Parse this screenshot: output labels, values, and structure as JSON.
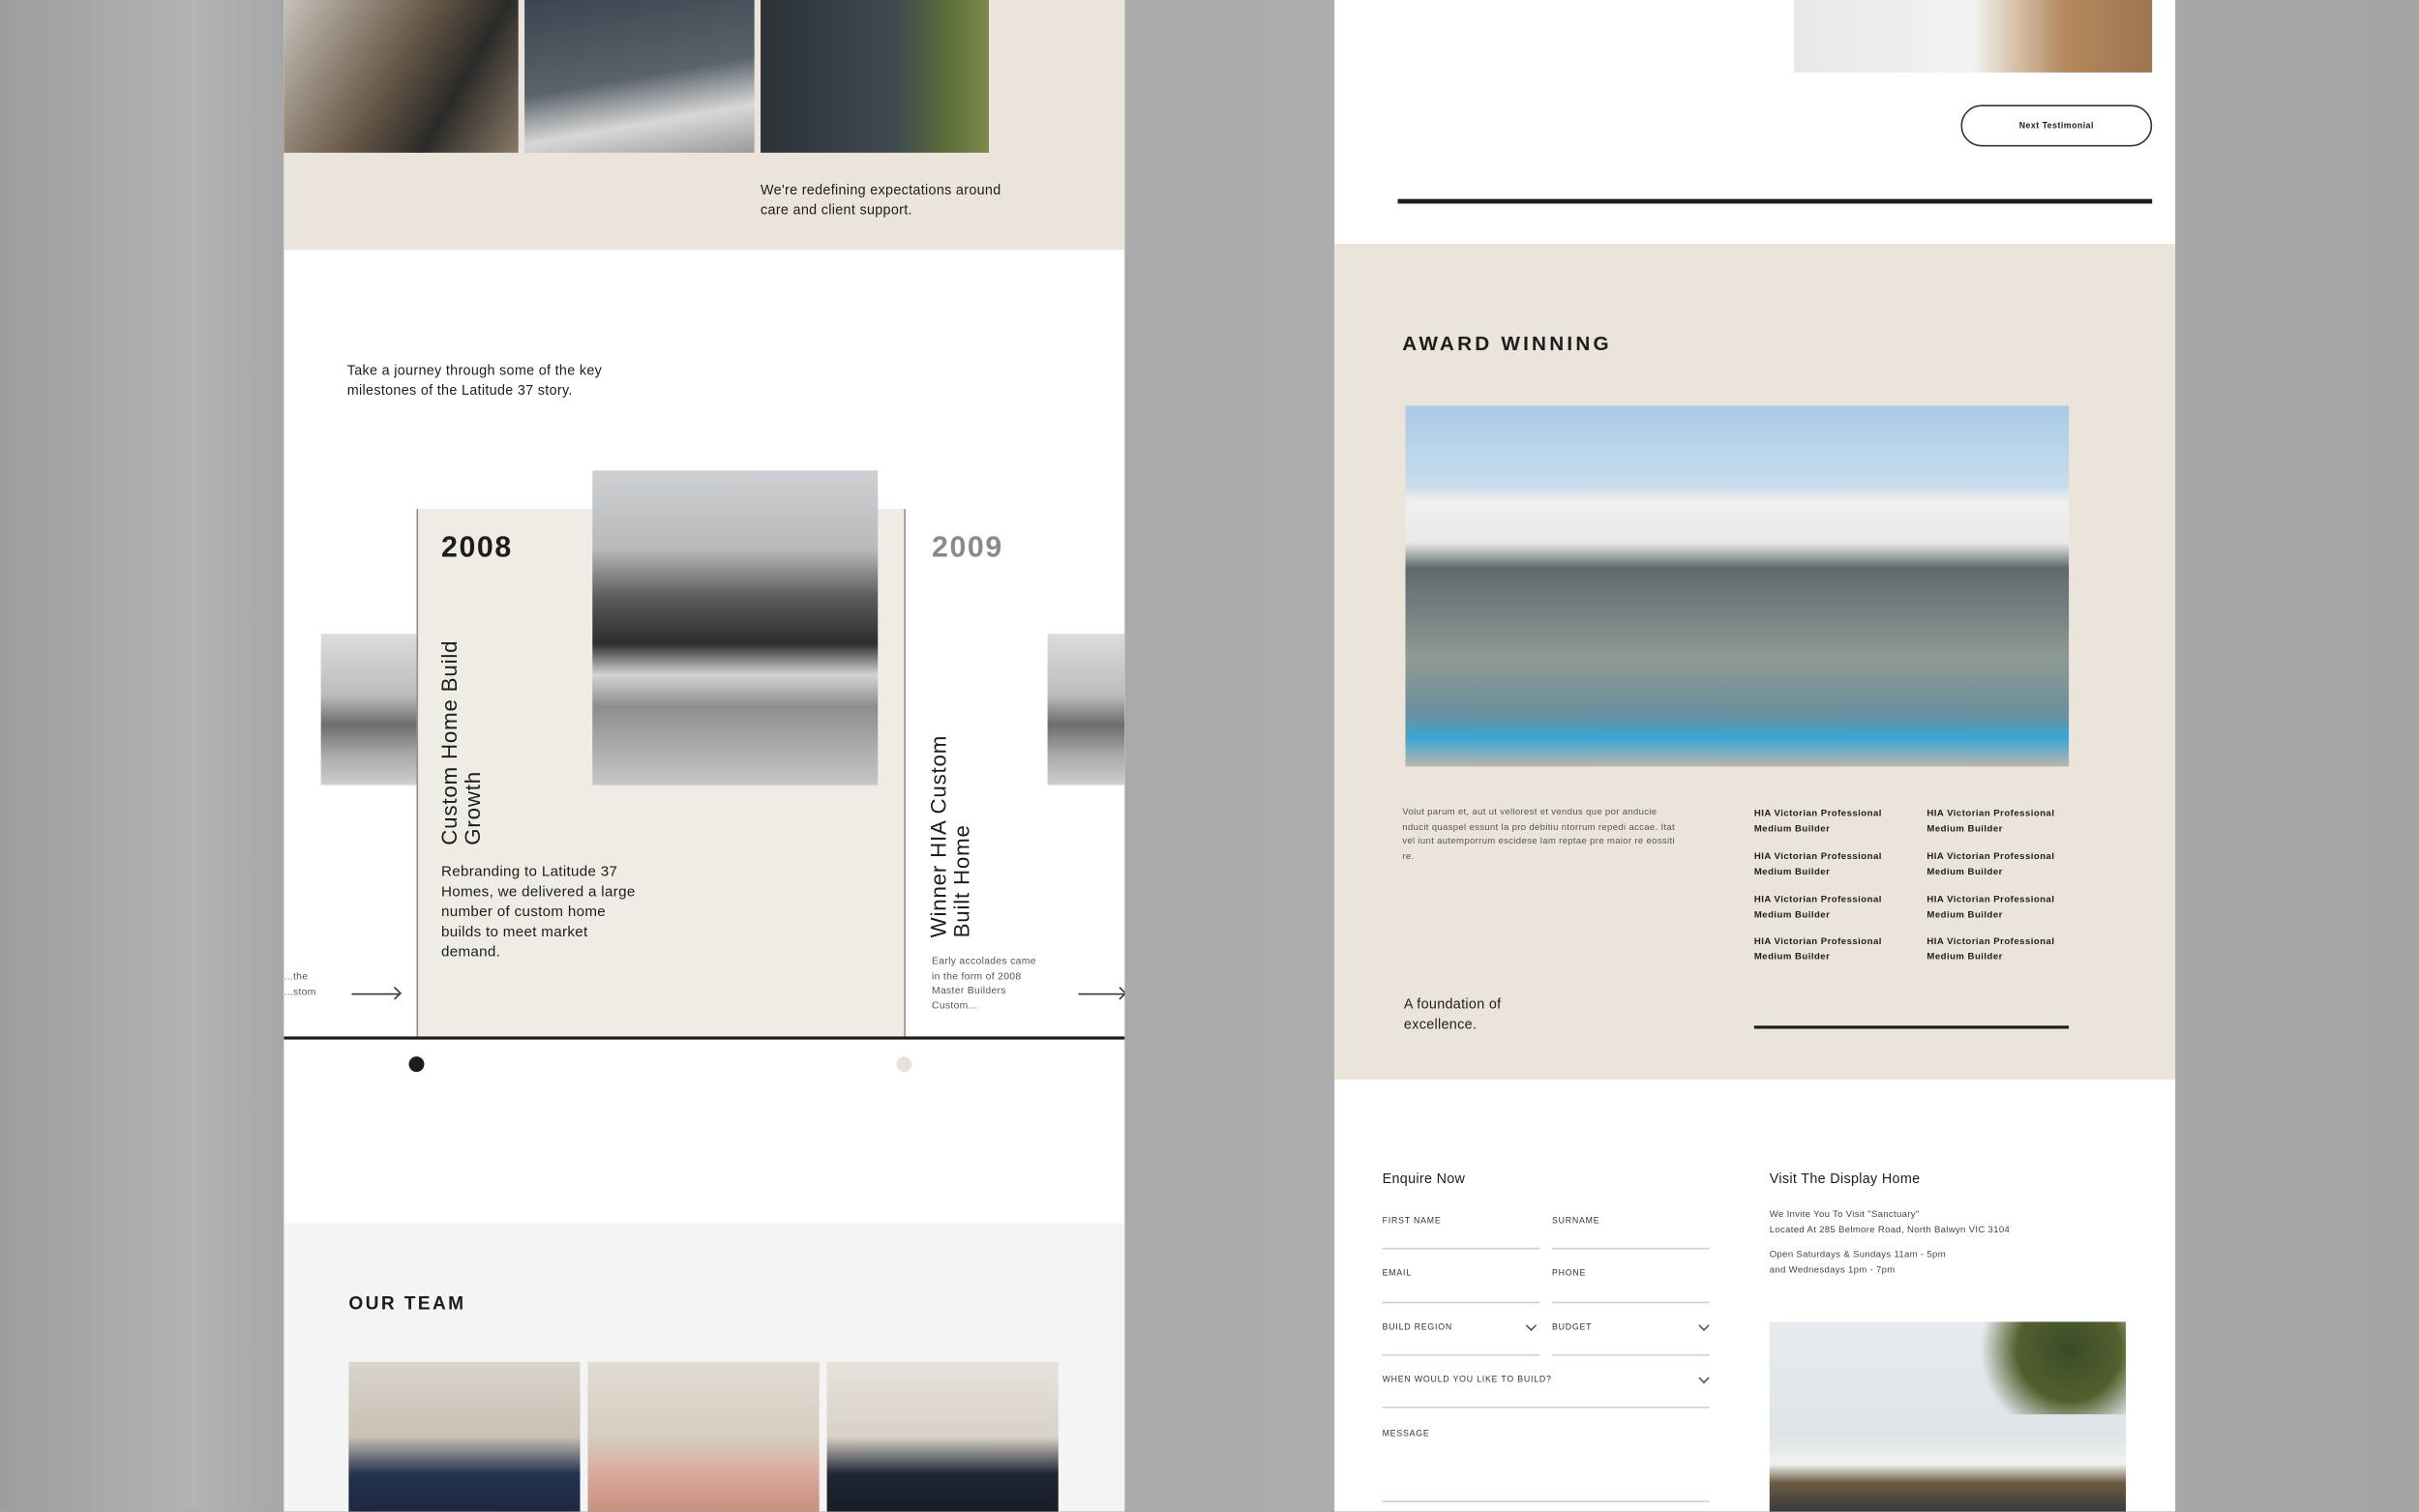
{
  "left_page": {
    "intro_text": "We're redefining expectations around care and client support.",
    "journey_text": "Take a journey through some of the key milestones of the Latitude 37 story.",
    "timeline": [
      {
        "year": "2008",
        "title": "Custom Home Build Growth",
        "description": "Rebranding to Latitude 37 Homes, we delivered a large number of custom home builds to meet market demand.",
        "active": true
      },
      {
        "year": "2009",
        "title": "Winner HIA Custom Built Home",
        "description": "Early accolades came in the form of 2008 Master Builders Custom...",
        "active": false
      }
    ],
    "prev_snippet": "...the ...stom",
    "team_heading": "OUR TEAM"
  },
  "right_page": {
    "next_testimonial_label": "Next Testimonial",
    "award_heading": "AWARD WINNING",
    "award_text": "Volut parum et, aut ut vellorest et vendus que por anducie nducit quaspel essunt la pro debitiu ntorrum repedi accae. Itat vel iunt autemporrum escidese lam reptae pre maior re eossiti re.",
    "awards": [
      "HIA Victorian Professional Medium Builder",
      "HIA Victorian Professional Medium Builder",
      "HIA Victorian Professional Medium Builder",
      "HIA Victorian Professional Medium Builder",
      "HIA Victorian Professional Medium Builder",
      "HIA Victorian Professional Medium Builder",
      "HIA Victorian Professional Medium Builder",
      "HIA Victorian Professional Medium Builder"
    ],
    "foundation_text": "A foundation of excellence.",
    "form": {
      "title": "Enquire Now",
      "first_name": "FIRST NAME",
      "surname": "SURNAME",
      "email": "EMAIL",
      "phone": "PHONE",
      "build_region": "BUILD REGION",
      "budget": "BUDGET",
      "when": "WHEN WOULD YOU LIKE TO BUILD?",
      "message": "MESSAGE"
    },
    "display_home": {
      "title": "Visit The Display Home",
      "line1": "We Invite You To Visit \"Sanctuary\"",
      "line2": "Located At 285 Belmore Road, North Balwyn VIC 3104",
      "hours1": "Open Saturdays & Sundays 11am - 5pm",
      "hours2": "and Wednesdays 1pm - 7pm"
    }
  },
  "colors": {
    "beige": "#ebe4da",
    "card": "#efebe5",
    "ink": "#1d1d1d",
    "light_gray": "#f4f4f4"
  }
}
